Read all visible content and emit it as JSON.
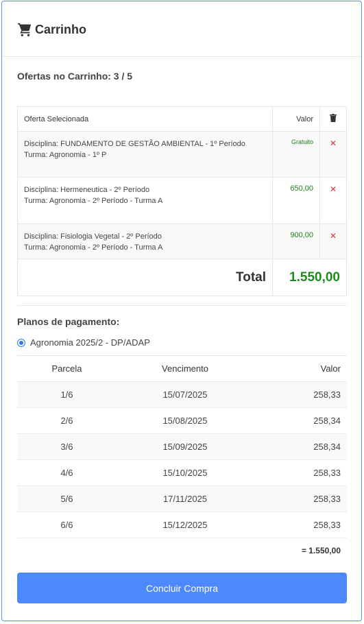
{
  "header": {
    "title": "Carrinho",
    "icon": "shopping-cart-icon"
  },
  "offers": {
    "count_label": "Ofertas no Carrinho: 3 / 5"
  },
  "cart": {
    "headers": {
      "offer": "Oferta Selecionada",
      "value": "Valor",
      "remove_icon": "trash-icon"
    },
    "items": [
      {
        "discipline": "Disciplina: FUNDAMENTO DE GESTÃO AMBIENTAL - 1º Período",
        "class": "Turma: Agronomia - 1º P",
        "price": "Gratuito",
        "remove": "✕"
      },
      {
        "discipline": "Disciplina: Hermeneutica - 2º Período",
        "class": "Turma: Agronomia - 2º Período - Turma A",
        "price": "650,00",
        "remove": "✕"
      },
      {
        "discipline": "Disciplina: Fisiologia Vegetal - 2º Período",
        "class": "Turma: Agronomia - 2º Período - Turma A",
        "price": "900,00",
        "remove": "✕"
      }
    ],
    "total_label": "Total",
    "total_value": "1.550,00"
  },
  "payment": {
    "title": "Planos de pagamento:",
    "plan_name": "Agronomia 2025/2 - DP/ADAP",
    "selected": true,
    "columns": [
      "Parcela",
      "Vencimento",
      "Valor"
    ],
    "rows": [
      {
        "installment": "1/6",
        "due": "15/07/2025",
        "value": "258,33"
      },
      {
        "installment": "2/6",
        "due": "15/08/2025",
        "value": "258,34"
      },
      {
        "installment": "3/6",
        "due": "15/09/2025",
        "value": "258,34"
      },
      {
        "installment": "4/6",
        "due": "15/10/2025",
        "value": "258,33"
      },
      {
        "installment": "5/6",
        "due": "17/11/2025",
        "value": "258,33"
      },
      {
        "installment": "6/6",
        "due": "15/12/2025",
        "value": "258,33"
      }
    ],
    "sum": "= 1.550,00"
  },
  "actions": {
    "buy_label": "Concluir Compra"
  },
  "colors": {
    "accent": "#4d88fc",
    "price_green": "#1e8a1e",
    "remove_red": "#d9363e",
    "border_blue": "#5b8ff0"
  }
}
